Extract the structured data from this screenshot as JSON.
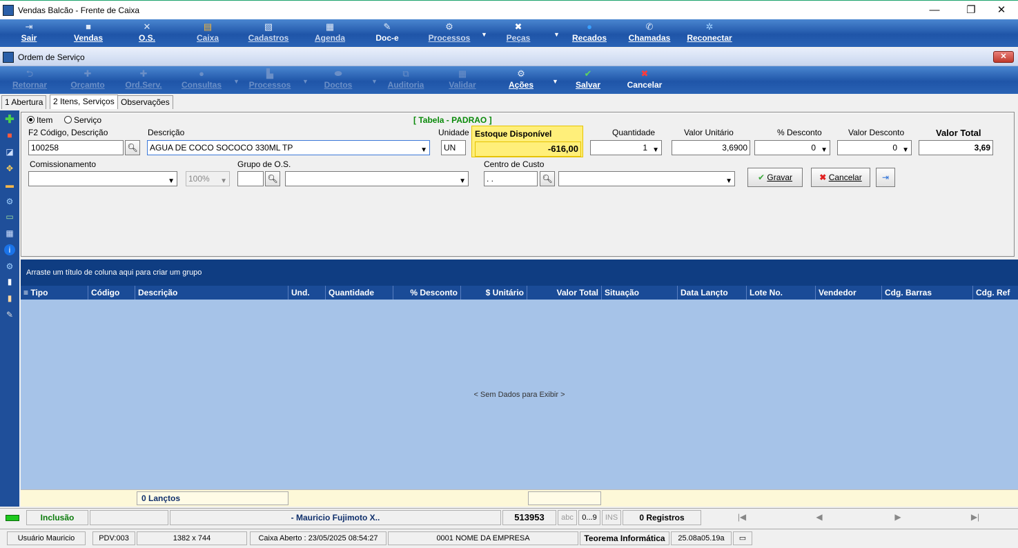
{
  "window": {
    "title": "Vendas Balcão - Frente de Caixa",
    "min": "—",
    "restore": "❐",
    "close": "✕"
  },
  "maintoolbar": [
    {
      "label": "Sair",
      "icon": "exit-icon"
    },
    {
      "label": "Vendas",
      "icon": "sales-icon"
    },
    {
      "label": "O.S.",
      "icon": "tools-icon"
    },
    {
      "label": "Caixa",
      "icon": "cashier-icon"
    },
    {
      "label": "Cadastros",
      "icon": "register-icon"
    },
    {
      "label": "Agenda",
      "icon": "calendar-icon"
    },
    {
      "label": "Doc-e",
      "icon": "document-icon"
    },
    {
      "label": "Processos",
      "icon": "gear-icon"
    },
    {
      "label": "Peças",
      "icon": "parts-icon"
    },
    {
      "label": "Recados",
      "icon": "message-icon"
    },
    {
      "label": "Chamadas",
      "icon": "phone-icon"
    },
    {
      "label": "Reconectar",
      "icon": "reconnect-icon"
    }
  ],
  "os_window": {
    "title": "Ordem de Serviço",
    "close": "✕"
  },
  "sectoolbar": [
    {
      "label": "Retornar"
    },
    {
      "label": "Orçamto"
    },
    {
      "label": "Ord.Serv."
    },
    {
      "label": "Consultas"
    },
    {
      "label": "Processos"
    },
    {
      "label": "Doctos"
    },
    {
      "label": "Auditoria"
    },
    {
      "label": "Validar"
    },
    {
      "label": "Ações"
    },
    {
      "label": "Salvar"
    },
    {
      "label": "Cancelar"
    }
  ],
  "tabs": [
    "1 Abertura",
    "2 Itens, Serviços",
    "Observações"
  ],
  "form": {
    "radio_item": "Item",
    "radio_servico": "Serviço",
    "tabela": "[ Tabela - PADRAO ]",
    "codigo_label": "F2 Código, Descrição",
    "codigo_value": "100258",
    "descricao_label": "Descrição",
    "descricao_value": "AGUA DE COCO SOCOCO 330ML TP",
    "unidade_label": "Unidade",
    "unidade_value": "UN",
    "estoque_label": "Estoque Disponível",
    "estoque_value": "-616,00",
    "quantidade_label": "Quantidade",
    "quantidade_value": "1",
    "valor_unit_label": "Valor Unitário",
    "valor_unit_value": "3,6900",
    "pct_desc_label": "% Desconto",
    "pct_desc_value": "0",
    "valor_desc_label": "Valor Desconto",
    "valor_desc_value": "0",
    "valor_total_label": "Valor Total",
    "valor_total_value": "3,69",
    "comissionamento_label": "Comissionamento",
    "pct_value": "100%",
    "grupo_label": "Grupo de O.S.",
    "centro_label": "Centro de Custo",
    "centro_value": ". .",
    "gravar": "Gravar",
    "cancelar": "Cancelar"
  },
  "grid": {
    "group_hint": "Arraste um título de coluna aqui para criar um grupo",
    "columns": [
      "Tipo",
      "Código",
      "Descrição",
      "Und.",
      "Quantidade",
      "% Desconto",
      "$ Unitário",
      "Valor Total",
      "Situação",
      "Data Lançto",
      "Lote No.",
      "Vendedor",
      "Cdg. Barras",
      "Cdg. Ref"
    ],
    "empty": "< Sem Dados para Exibir >",
    "footer_count": "0 Lançtos"
  },
  "status1": {
    "mode": "Inclusão",
    "user": "- Mauricio Fujimoto X..",
    "number": "513953",
    "abc": "abc",
    "num": "0...9",
    "ins": "INS",
    "registros": "0 Registros",
    "nav_first": "|◀",
    "nav_prev": "◀",
    "nav_next": "▶",
    "nav_last": "▶|"
  },
  "status2": {
    "usuario": "Usuário Mauricio",
    "pdv": "PDV:003",
    "res": "1382 x 744",
    "caixa": "Caixa Aberto : 23/05/2025 08:54:27",
    "empresa": "0001 NOME DA EMPRESA",
    "teorema": "Teorema Informática",
    "versao": "25.08a05.19a"
  }
}
